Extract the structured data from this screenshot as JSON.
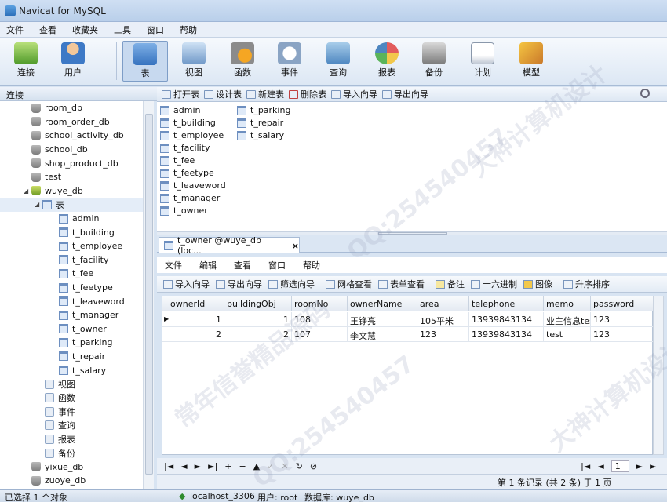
{
  "window": {
    "title": "Navicat for MySQL"
  },
  "menu": [
    "文件",
    "查看",
    "收藏夹",
    "工具",
    "窗口",
    "帮助"
  ],
  "toolbar": [
    {
      "label": "连接",
      "icon": "plug-icon",
      "active": false
    },
    {
      "label": "用户",
      "icon": "user-icon",
      "active": false
    },
    {
      "label": "表",
      "icon": "table-icon",
      "active": true
    },
    {
      "label": "视图",
      "icon": "view-icon",
      "active": false
    },
    {
      "label": "函数",
      "icon": "function-icon",
      "active": false
    },
    {
      "label": "事件",
      "icon": "event-clock-icon",
      "active": false
    },
    {
      "label": "查询",
      "icon": "query-icon",
      "active": false
    },
    {
      "label": "报表",
      "icon": "report-icon",
      "active": false
    },
    {
      "label": "备份",
      "icon": "backup-icon",
      "active": false
    },
    {
      "label": "计划",
      "icon": "schedule-icon",
      "active": false
    },
    {
      "label": "模型",
      "icon": "model-icon",
      "active": false
    }
  ],
  "left_header": "连接",
  "tree": {
    "databases_top": [
      "room_db",
      "room_order_db",
      "school_activity_db",
      "school_db",
      "shop_product_db",
      "test"
    ],
    "open_db": "wuye_db",
    "tables_label": "表",
    "tables": [
      "admin",
      "t_building",
      "t_employee",
      "t_facility",
      "t_fee",
      "t_feetype",
      "t_leaveword",
      "t_manager",
      "t_owner",
      "t_parking",
      "t_repair",
      "t_salary"
    ],
    "other_nodes": [
      "视图",
      "函数",
      "事件",
      "查询",
      "报表",
      "备份"
    ],
    "databases_bottom": [
      "yixue_db",
      "zuoye_db"
    ]
  },
  "object_toolbar": [
    "打开表",
    "设计表",
    "新建表",
    "删除表",
    "导入向导",
    "导出向导"
  ],
  "objects": {
    "col1": [
      "admin",
      "t_building",
      "t_employee",
      "t_facility",
      "t_fee",
      "t_feetype",
      "t_leaveword",
      "t_manager",
      "t_owner"
    ],
    "col2": [
      "t_parking",
      "t_repair",
      "t_salary"
    ]
  },
  "tab": {
    "label": "t_owner @wuye_db (loc...",
    "close": "×"
  },
  "inner_menu": [
    "文件",
    "编辑",
    "查看",
    "窗口",
    "帮助"
  ],
  "inner_toolbar": [
    "导入向导",
    "导出向导",
    "筛选向导",
    "网格查看",
    "表单查看",
    "备注",
    "十六进制",
    "图像",
    "升序排序"
  ],
  "grid": {
    "columns": [
      "ownerId",
      "buildingObj",
      "roomNo",
      "ownerName",
      "area",
      "telephone",
      "memo",
      "password"
    ],
    "rows": [
      [
        "1",
        "1",
        "108",
        "王铮亮",
        "105平米",
        "13939843134",
        "业主信息tes",
        "123"
      ],
      [
        "2",
        "2",
        "107",
        "李文慧",
        "123",
        "13939843134",
        "test",
        "123"
      ]
    ]
  },
  "nav": {
    "buttons": [
      "|◄",
      "◄",
      "►",
      "►|",
      "+",
      "−",
      "▲",
      "✓",
      "✕",
      "↻",
      "⊘"
    ],
    "page": "1"
  },
  "record_status": "第 1 条记录 (共 2 条) 于 1 页",
  "status": {
    "selected": "已选择 1 个对象",
    "host": "localhost_3306",
    "user": "用户: root",
    "db": "数据库: wuye_db"
  },
  "watermarks": [
    "QQ:254540457",
    "大神计算机设计",
    "常年信誉精品源码"
  ]
}
